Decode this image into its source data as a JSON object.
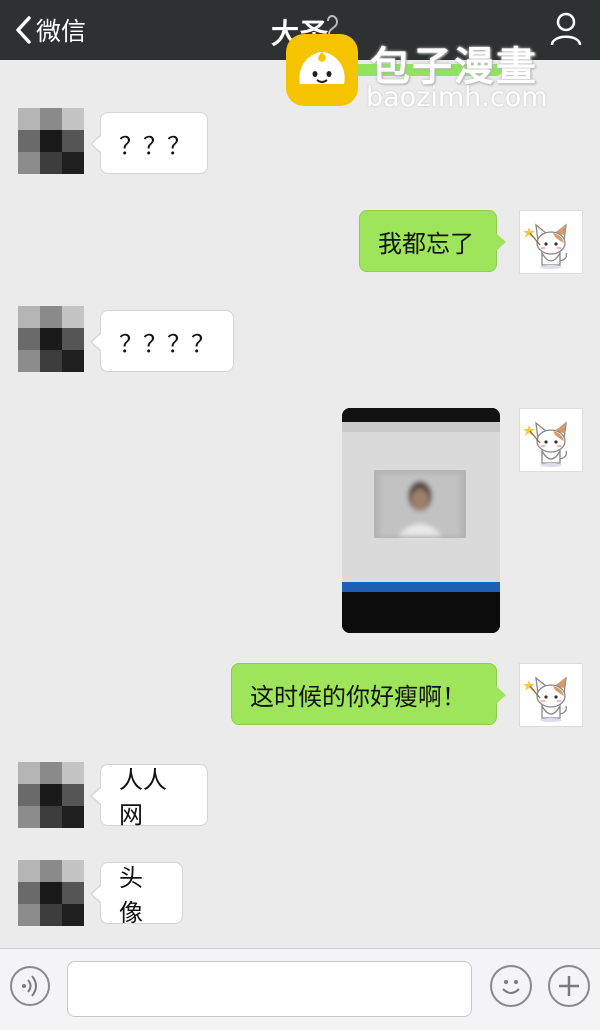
{
  "header": {
    "back_label": "微信",
    "title": "大圣"
  },
  "watermark": {
    "brand": "包子漫畫",
    "url": "baozimh.com"
  },
  "messages": [
    {
      "side": "left",
      "type": "text",
      "text": "？？？"
    },
    {
      "side": "right",
      "type": "text",
      "text": "我都忘了"
    },
    {
      "side": "left",
      "type": "text",
      "text": "？？？？"
    },
    {
      "side": "right",
      "type": "image",
      "image": "photo-of-screen-with-blurred-profile-picture"
    },
    {
      "side": "right",
      "type": "text",
      "text": "这时候的你好瘦啊！"
    },
    {
      "side": "left",
      "type": "text",
      "text": "人人网"
    },
    {
      "side": "left",
      "type": "text",
      "text": "头像"
    }
  ],
  "input_bar": {
    "value": "",
    "icons": [
      "voice-icon",
      "emoji-icon",
      "plus-icon"
    ]
  },
  "colors": {
    "header_bg": "#2e3132",
    "chat_bg": "#ebebeb",
    "sent_bubble": "#9fe55b",
    "received_bubble": "#ffffff",
    "watermark_logo": "#f6c300"
  },
  "icons": {
    "back": "chevron-left-icon",
    "profile": "person-icon",
    "left_avatar": "pixelated-avatar",
    "right_avatar": "cat-avatar"
  }
}
